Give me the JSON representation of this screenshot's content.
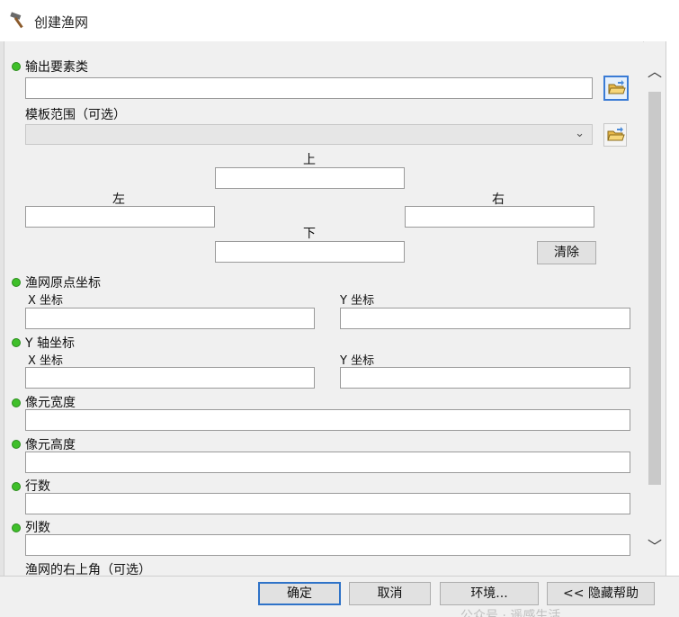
{
  "window": {
    "title": "创建渔网",
    "icon": "hammer-icon"
  },
  "output_feature_class": {
    "label": "输出要素类",
    "value": "",
    "browse_icon": "open-folder-icon"
  },
  "template_extent": {
    "label": "模板范围（可选）",
    "selected": "",
    "dropdown_icon": "chevron-down-icon",
    "browse_icon": "open-folder-icon",
    "top_label": "上",
    "top_value": "",
    "left_label": "左",
    "left_value": "",
    "right_label": "右",
    "right_value": "",
    "bottom_label": "下",
    "bottom_value": "",
    "clear_label": "清除"
  },
  "origin": {
    "label": "渔网原点坐标",
    "x_label": "X 坐标",
    "x_value": "",
    "y_label": "Y 坐标",
    "y_value": ""
  },
  "y_axis": {
    "label": "Y 轴坐标",
    "x_label": "X 坐标",
    "x_value": "",
    "y_label": "Y 坐标",
    "y_value": ""
  },
  "cell_width": {
    "label": "像元宽度",
    "value": ""
  },
  "cell_height": {
    "label": "像元高度",
    "value": ""
  },
  "rows": {
    "label": "行数",
    "value": ""
  },
  "columns": {
    "label": "列数",
    "value": ""
  },
  "opposite_corner": {
    "label": "渔网的右上角（可选）"
  },
  "scrollbar": {
    "up_icon": "chevron-up-icon",
    "down_icon": "chevron-down-icon"
  },
  "buttons": {
    "ok": "确定",
    "cancel": "取消",
    "environments": "环境...",
    "hide_help": "<< 隐藏帮助"
  },
  "watermark": "公众号 · 遥感生活",
  "colors": {
    "required_dot": "#3fbf2a",
    "focus_border": "#2f73c8",
    "panel_bg": "#f0f0f0"
  }
}
